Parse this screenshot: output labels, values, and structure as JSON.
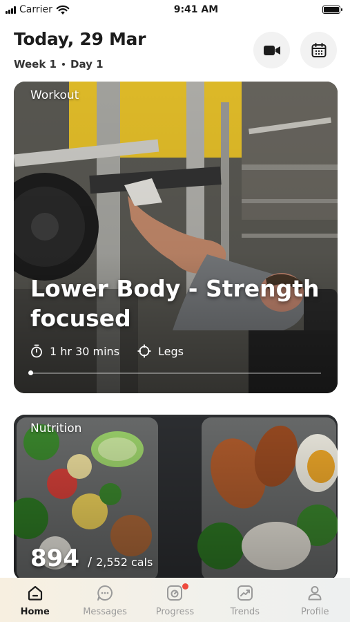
{
  "status_bar": {
    "carrier": "Carrier",
    "time": "9:41 AM"
  },
  "header": {
    "title": "Today, 29 Mar",
    "week": "Week 1",
    "day": "Day 1"
  },
  "actions": [
    {
      "icon": "video-camera-icon"
    },
    {
      "icon": "calendar-icon"
    }
  ],
  "workout_card": {
    "label": "Workout",
    "title": "Lower Body - Strength focused",
    "duration": "1 hr 30 mins",
    "target": "Legs",
    "progress": 0
  },
  "nutrition_card": {
    "label": "Nutrition",
    "calories": "894",
    "separator": "/",
    "calorie_target": "2,552 cals"
  },
  "tab_bar": {
    "tabs": [
      {
        "label": "Home",
        "icon": "home-icon",
        "active": true
      },
      {
        "label": "Messages",
        "icon": "messages-icon",
        "active": false
      },
      {
        "label": "Progress",
        "icon": "progress-icon",
        "active": false,
        "badge": true
      },
      {
        "label": "Trends",
        "icon": "trends-icon",
        "active": false
      },
      {
        "label": "Profile",
        "icon": "profile-icon",
        "active": false
      }
    ]
  },
  "colors": {
    "accent_badge": "#ee4b3e",
    "gym_yellow": "#e8c22a",
    "active_tab": "#1c1c1c",
    "inactive_tab": "#9a9a9a"
  }
}
